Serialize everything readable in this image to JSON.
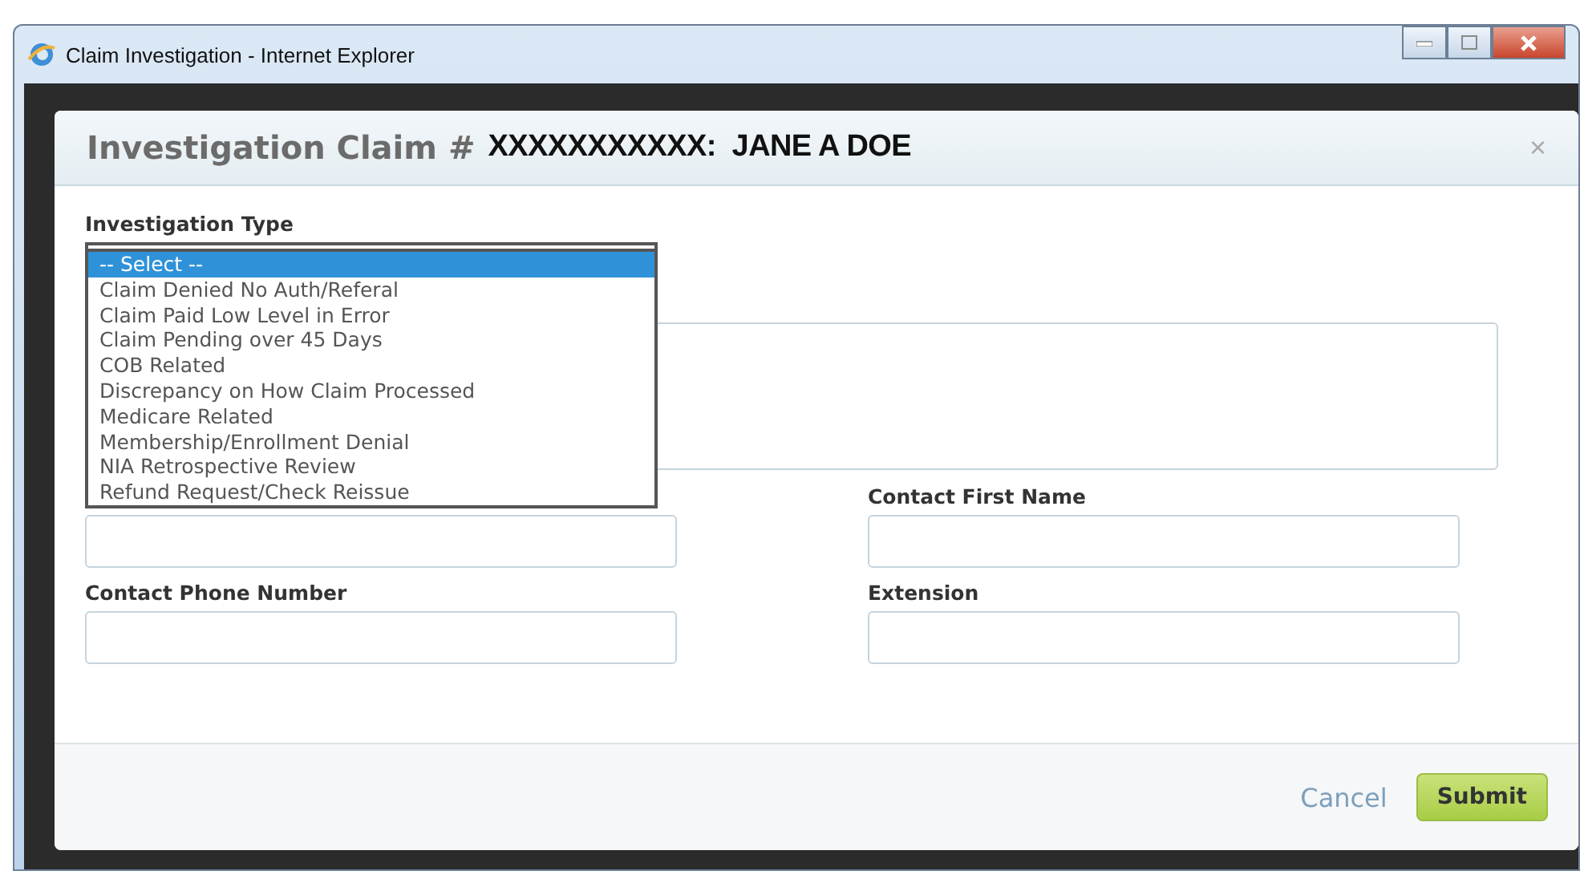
{
  "window": {
    "title": "Claim Investigation - Internet Explorer"
  },
  "dialog": {
    "title": "Investigation Claim #",
    "claim": "XXXXXXXXXXX:  JANE A DOE",
    "close": "×"
  },
  "investigation_type": {
    "label": "Investigation Type",
    "expanded": true,
    "options": [
      {
        "label": "-- Select --",
        "selected": true
      },
      {
        "label": "Claim Denied No Auth/Referal",
        "selected": false
      },
      {
        "label": "Claim Paid Low Level in Error",
        "selected": false
      },
      {
        "label": "Claim Pending over 45 Days",
        "selected": false
      },
      {
        "label": "COB Related",
        "selected": false
      },
      {
        "label": "Discrepancy on How Claim Processed",
        "selected": false
      },
      {
        "label": "Medicare Related",
        "selected": false
      },
      {
        "label": "Membership/Enrollment Denial",
        "selected": false
      },
      {
        "label": "NIA Retrospective Review",
        "selected": false
      },
      {
        "label": "Refund Request/Check Reissue",
        "selected": false
      }
    ]
  },
  "fields": [
    {
      "label": "Contact First Name"
    },
    {
      "label": "Contact Phone Number"
    },
    {
      "label": "Extension"
    }
  ],
  "buttons": {
    "cancel": "Cancel",
    "submit": "Submit"
  }
}
